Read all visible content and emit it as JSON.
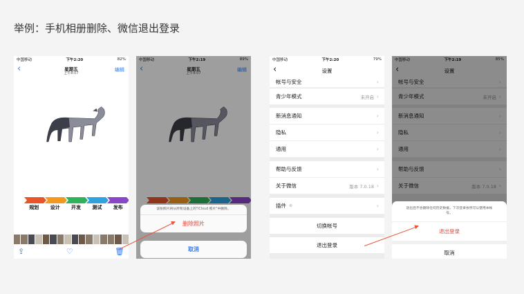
{
  "page_title": "举例：手机相册删除、微信退出登录",
  "colors": {
    "ios_blue": "#2f7bf5",
    "destructive": "#e8443a",
    "annotation": "#e8543a"
  },
  "phone1": {
    "status": {
      "carrier": "中国移动",
      "time": "下午2:20",
      "battery": "82%"
    },
    "nav": {
      "back_icon": "chevron-left-icon",
      "title": "星期五",
      "subtitle": "上午8:07",
      "edit": "编辑"
    },
    "steps": [
      "规划",
      "设计",
      "开发",
      "测试",
      "发布"
    ],
    "toolbar": {
      "share_icon": "share-icon",
      "like_icon": "heart-icon",
      "delete_icon": "trash-icon"
    }
  },
  "phone2": {
    "status": {
      "carrier": "中国移动",
      "time": "下午2:19",
      "battery": "89%"
    },
    "nav": {
      "title": "星期五",
      "subtitle": "上午8:07",
      "edit": "编辑"
    },
    "sheet": {
      "message": "该张照片将从所有设备上的\"iCloud 照片\"中删除。",
      "action": "删除照片",
      "cancel": "取消"
    }
  },
  "phone3": {
    "status": {
      "carrier": "中国移动",
      "time": "下午2:20",
      "battery": "79%"
    },
    "nav": {
      "title": "设置"
    },
    "rows": [
      {
        "label": "帐号与安全",
        "value": ""
      },
      {
        "label": "青少年模式",
        "value": "未开启"
      },
      {
        "label": "新消息通知",
        "value": ""
      },
      {
        "label": "隐私",
        "value": ""
      },
      {
        "label": "通用",
        "value": ""
      },
      {
        "label": "帮助与反馈",
        "value": ""
      },
      {
        "label": "关于微信",
        "value": "版本 7.0.18"
      },
      {
        "label": "插件",
        "value": ""
      }
    ],
    "switch_account": "切换帐号",
    "logout": "退出登录"
  },
  "phone4": {
    "status": {
      "carrier": "中国移动",
      "time": "下午2:19",
      "battery": "85%"
    },
    "nav": {
      "title": "设置"
    },
    "rows": [
      {
        "label": "帐号与安全",
        "value": ""
      },
      {
        "label": "青少年模式",
        "value": "未开启"
      },
      {
        "label": "新消息通知",
        "value": ""
      },
      {
        "label": "隐私",
        "value": ""
      },
      {
        "label": "通用",
        "value": ""
      },
      {
        "label": "帮助与反馈",
        "value": ""
      },
      {
        "label": "关于微信",
        "value": "版本 7.0.18"
      }
    ],
    "sheet": {
      "message": "退出后不会删除任何历史数据，下次登录依然可以使用本帐号。",
      "action": "退出登录",
      "cancel": "取消"
    }
  }
}
